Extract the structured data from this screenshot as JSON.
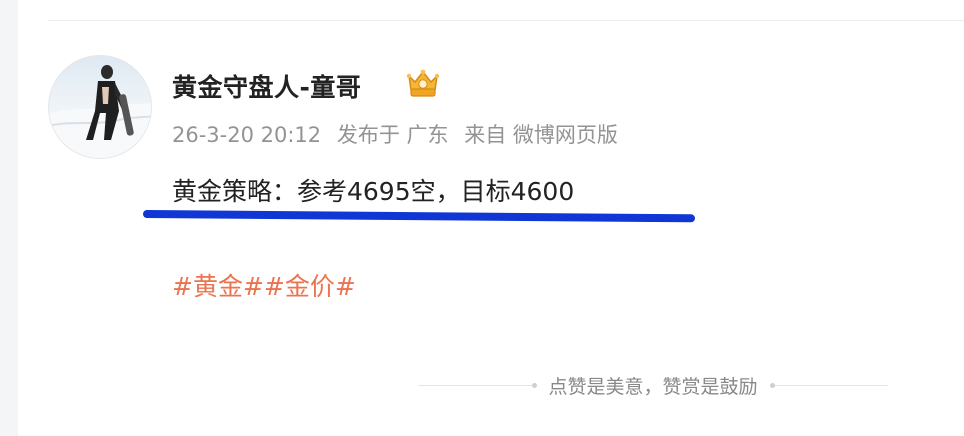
{
  "post": {
    "author": "黄金守盘人-童哥",
    "time": "26-3-20 20:12",
    "location": "发布于 广东",
    "source": "来自 微博网页版",
    "text": "黄金策略：参考4695空，目标4600",
    "topics": [
      "#黄金#",
      "#金价#"
    ]
  },
  "footer": {
    "reward_text": "点赞是美意，赞赏是鼓励"
  },
  "colors": {
    "topic": "#eb7350",
    "underline": "#1037d6",
    "meta": "#939393"
  },
  "icons": {
    "badge": "golden-vip-crown-icon"
  }
}
